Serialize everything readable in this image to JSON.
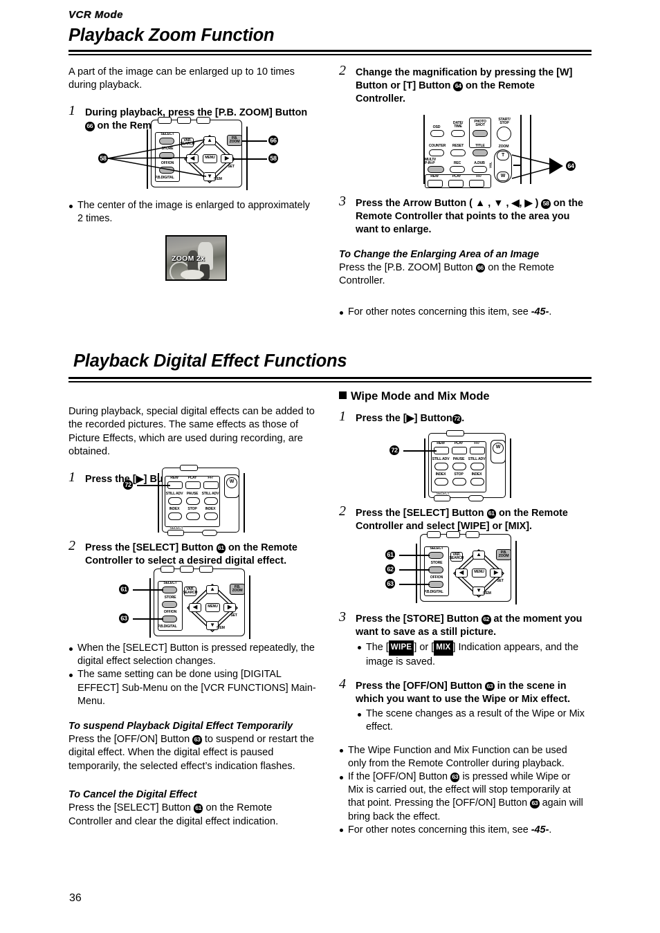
{
  "page": {
    "mode_tag": "VCR Mode",
    "page_number": "36"
  },
  "section1": {
    "title": "Playback Zoom Function",
    "intro": "A part of the image can be enlarged up to 10 times during playback.",
    "steps": [
      {
        "num": "1",
        "text_a": "During playback, press the [P.B. ZOOM] Button",
        "badge": "66",
        "text_b": "on the Remote Controller."
      },
      {
        "num": "2",
        "text_a": "Change the magnification by pressing the [W] Button or [T] Button",
        "badge": "64",
        "text_b": "on the Remote Controller."
      },
      {
        "num": "3",
        "text_a": "Press the Arrow Button ( ▲ , ▼ , ◀, ▶ )",
        "badge": "58",
        "text_b": "on the Remote Controller that points to the area you want to enlarge."
      }
    ],
    "note_center": "The center of the image is enlarged to approximately 2 times.",
    "photo_overlay": "ZOOM 2x",
    "change_area": {
      "heading": "To Change the Enlarging Area of an Image",
      "text_a": "Press the [P.B. ZOOM] Button",
      "badge": "66",
      "text_b": "on the Remote Controller."
    },
    "other_notes": {
      "text_a": "For other notes concerning this item, see",
      "ref": "-45-",
      "text_b": "."
    }
  },
  "section2": {
    "title": "Playback Digital Effect Functions",
    "intro": "During playback, special digital effects can be added to the recorded pictures. The same effects as those of Picture Effects, which are used during recording, are obtained.",
    "steps": [
      {
        "num": "1",
        "text_a": "Press the [▶] Button",
        "badge": "72",
        "text_b": "."
      },
      {
        "num": "2",
        "text_a": "Press the [SELECT] Button",
        "badge": "61",
        "text_b": "on the Remote Controller to select a desired digital effect."
      }
    ],
    "bullets": [
      "When the [SELECT] Button is pressed repeatedly, the digital effect selection changes.",
      "The same setting can be done using [DIGITAL EFFECT] Sub-Menu on the [VCR FUNCTIONS] Main-Menu."
    ],
    "suspend": {
      "heading": "To suspend Playback Digital Effect Temporarily",
      "text_a": "Press the [OFF/ON] Button",
      "badge": "63",
      "text_b": "to suspend or restart the digital effect. When the digital effect is paused temporarily, the selected effect’s indication flashes."
    },
    "cancel": {
      "heading": "To Cancel the Digital Effect",
      "text_a": "Press the [SELECT] Button",
      "badge": "61",
      "text_b": "on the Remote Controller and clear the digital effect indication."
    }
  },
  "section3": {
    "heading": "Wipe Mode and Mix Mode",
    "steps": [
      {
        "num": "1",
        "text_a": "Press the [▶] Button",
        "badge": "72",
        "text_b": "."
      },
      {
        "num": "2",
        "text_a": "Press the [SELECT] Button",
        "badge": "61",
        "text_b": "on the Remote Controller and select [WIPE] or [MIX]."
      },
      {
        "num": "3",
        "text_a": "Press the [STORE] Button",
        "badge": "62",
        "text_b": "at the moment you want to save as a still picture."
      },
      {
        "num": "4",
        "text_a": "Press the [OFF/ON] Button",
        "badge": "63",
        "text_b": "in the scene in which you want to use the Wipe or Mix effect."
      }
    ],
    "note_step3": {
      "pre": "The  [",
      "ind1": "WIPE",
      "mid": "] or [",
      "ind2": "MIX",
      "post": "] Indication appears, and the image is saved."
    },
    "note_step4": "The scene changes as a result of the Wipe or Mix effect.",
    "bullets": [
      "The Wipe Function and Mix Function can be used only from the Remote Controller during playback.",
      "If the [OFF/ON] Button ③ is pressed while Wipe or Mix is carried out, the effect will stop temporarily at that point. Pressing the [OFF/ON] Button ③ again will bring back the effect."
    ],
    "bullet2": {
      "a": "If the [OFF/ON] Button",
      "badge1": "63",
      "b": "is pressed while Wipe or Mix is carried out, the effect will stop temporarily at that point. Pressing the [OFF/ON] Button",
      "badge2": "63",
      "c": "again will bring back the effect."
    },
    "other_notes": {
      "text_a": "For other notes concerning this item, see",
      "ref": "-45-",
      "text_b": "."
    }
  },
  "remotes": {
    "labels": {
      "select": "SELECT",
      "store": "STORE",
      "offon": "OFF/ON",
      "pb_digital": "P.B.DIGITAL",
      "var_search": "VAR.\nSEARCH",
      "menu": "MENU",
      "set": "SET",
      "item": "ITEM",
      "pb_zoom": "P.B.\nZOOM",
      "osd": "OSD",
      "date_time": "DATE/\nTIME",
      "photo_shot": "PHOTO\nSHOT",
      "start_stop": "START/\nSTOP",
      "counter": "COUNTER",
      "reset": "RESET",
      "title": "TITLE",
      "zoom": "ZOOM",
      "zoom_t": "T",
      "zoom_w": "W",
      "multi_pinp": "MULTI/\nP-IN-P",
      "rec": "REC",
      "adub": "A.DUB",
      "rew": "REW",
      "play": "PLAY",
      "ff": "FF/",
      "still_adv": "STILL ADV",
      "pause": "PAUSE",
      "index": "INDEX",
      "stop": "STOP",
      "w_btn": "W",
      "vol": "VOL"
    },
    "callouts": {
      "c58": "58",
      "c61": "61",
      "c62": "62",
      "c63": "63",
      "c64": "64",
      "c66": "66",
      "c72": "72"
    }
  }
}
